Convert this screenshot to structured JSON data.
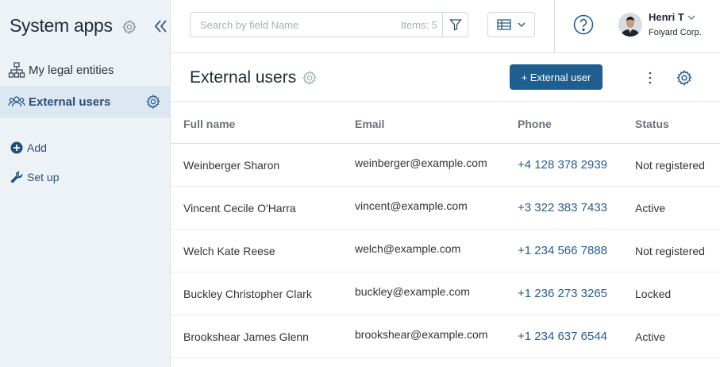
{
  "sidebar": {
    "title": "System apps",
    "items": [
      {
        "label": "My legal entities",
        "active": false
      },
      {
        "label": "External users",
        "active": true
      }
    ],
    "actions": [
      {
        "label": "Add"
      },
      {
        "label": "Set up"
      }
    ]
  },
  "topbar": {
    "search_placeholder": "Search by field Name",
    "items_count": "Items: 5",
    "user": {
      "name": "Henri T",
      "org": "Foiyard Corp."
    }
  },
  "header": {
    "title": "External users",
    "primary_button": "+ External user"
  },
  "table": {
    "columns": [
      "Full name",
      "Email",
      "Phone",
      "Status"
    ],
    "rows": [
      {
        "name": "Weinberger Sharon",
        "email": "weinberger@example.com",
        "phone": "+4 128 378 2939",
        "status": "Not registered"
      },
      {
        "name": "Vincent Cecile O'Harra",
        "email": "vincent@example.com",
        "phone": "+3 322 383 7433",
        "status": "Active"
      },
      {
        "name": "Welch Kate Reese",
        "email": "welch@example.com",
        "phone": "+1 234 566 7888",
        "status": "Not registered"
      },
      {
        "name": "Buckley Christopher Clark",
        "email": "buckley@example.com",
        "phone": "+1 236 273 3265",
        "status": "Locked"
      },
      {
        "name": "Brookshear James Glenn",
        "email": "brookshear@example.com",
        "phone": "+1 234 637 6544",
        "status": "Active"
      }
    ]
  },
  "colors": {
    "accent": "#1f5f8f",
    "sidebar_bg": "#edf2f7",
    "active_item_bg": "#dce7f2",
    "link": "#2a5b8a"
  }
}
